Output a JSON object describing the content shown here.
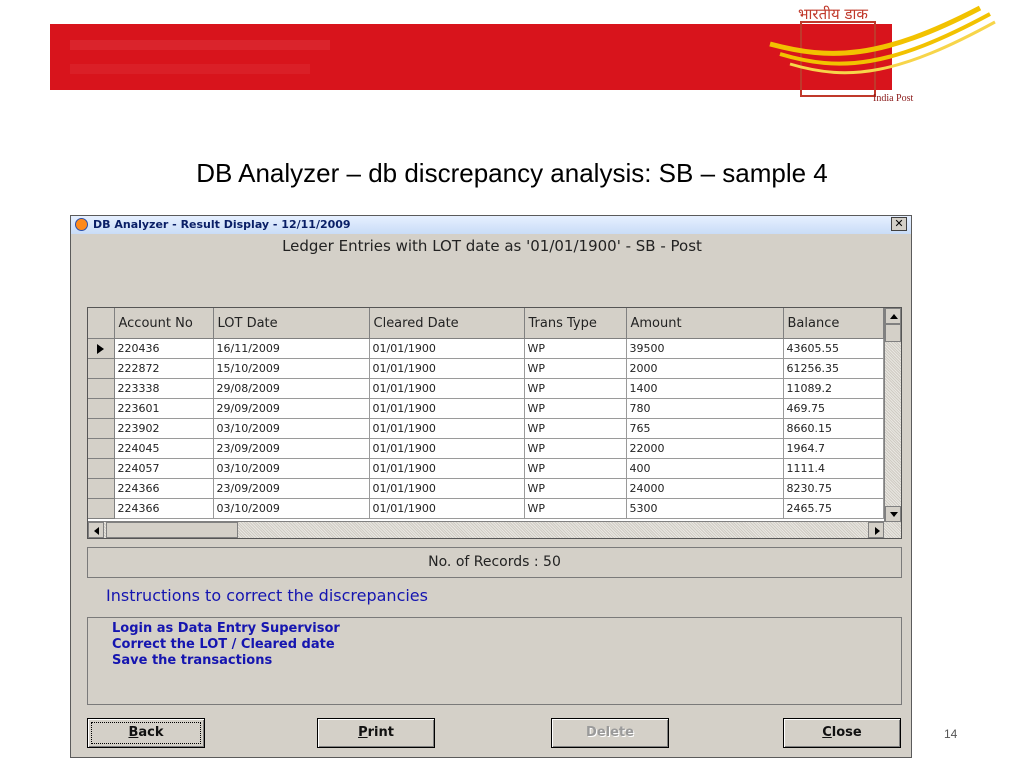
{
  "slide": {
    "logo_hindi": "भारतीय डाक",
    "logo_caption": "India Post",
    "title": "DB Analyzer – db discrepancy analysis: SB – sample 4",
    "page_number": "14"
  },
  "window": {
    "title": "DB Analyzer - Result Display - 12/11/2009",
    "close_glyph": "✕",
    "report_heading": "Ledger Entries with LOT date as '01/01/1900' - SB - Post"
  },
  "grid": {
    "columns": [
      "Account No",
      "LOT Date",
      "Cleared Date",
      "Trans Type",
      "Amount",
      "Balance"
    ],
    "rows": [
      {
        "account": "220436",
        "lot": "16/11/2009",
        "cleared": "01/01/1900",
        "type": "WP",
        "amount": "39500",
        "balance": "43605.55"
      },
      {
        "account": "222872",
        "lot": "15/10/2009",
        "cleared": "01/01/1900",
        "type": "WP",
        "amount": "2000",
        "balance": "61256.35"
      },
      {
        "account": "223338",
        "lot": "29/08/2009",
        "cleared": "01/01/1900",
        "type": "WP",
        "amount": "1400",
        "balance": "11089.2"
      },
      {
        "account": "223601",
        "lot": "29/09/2009",
        "cleared": "01/01/1900",
        "type": "WP",
        "amount": "780",
        "balance": "469.75"
      },
      {
        "account": "223902",
        "lot": "03/10/2009",
        "cleared": "01/01/1900",
        "type": "WP",
        "amount": "765",
        "balance": "8660.15"
      },
      {
        "account": "224045",
        "lot": "23/09/2009",
        "cleared": "01/01/1900",
        "type": "WP",
        "amount": "22000",
        "balance": "1964.7"
      },
      {
        "account": "224057",
        "lot": "03/10/2009",
        "cleared": "01/01/1900",
        "type": "WP",
        "amount": "400",
        "balance": "1111.4"
      },
      {
        "account": "224366",
        "lot": "23/09/2009",
        "cleared": "01/01/1900",
        "type": "WP",
        "amount": "24000",
        "balance": "8230.75"
      },
      {
        "account": "224366",
        "lot": "03/10/2009",
        "cleared": "01/01/1900",
        "type": "WP",
        "amount": "5300",
        "balance": "2465.75"
      }
    ],
    "current_row_indicator": "arrow-right-icon"
  },
  "records_text": "No. of Records : 50",
  "instructions": {
    "heading": "Instructions to correct the discrepancies",
    "lines": [
      "Login as Data Entry Supervisor",
      "Correct the LOT / Cleared date",
      "Save the transactions"
    ]
  },
  "buttons": {
    "back": {
      "mnemonic": "B",
      "rest": "ack"
    },
    "print": {
      "mnemonic": "P",
      "rest": "rint"
    },
    "delete": {
      "label": "Delete",
      "disabled": true
    },
    "close": {
      "mnemonic": "C",
      "rest": "lose"
    }
  },
  "colors": {
    "banner_red": "#d8141c",
    "instruction_blue": "#1515b0",
    "window_face": "#d4d0c8"
  }
}
